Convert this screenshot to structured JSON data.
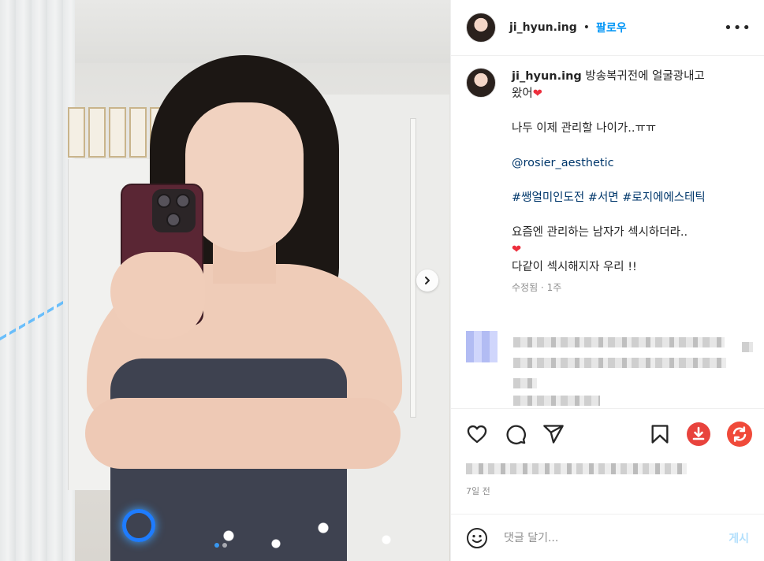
{
  "header": {
    "username": "ji_hyun.ing",
    "separator": "•",
    "follow_label": "팔로우",
    "more_label": "•••"
  },
  "caption": {
    "username": "ji_hyun.ing",
    "line1": "방송복귀전에 얼굴광내고",
    "line2": "왔어",
    "line3": "나두 이제 관리할 나이가..ㅠㅠ",
    "mention": "@rosier_aesthetic",
    "hashtags": "#쌩얼미인도전 #서면 #로지에에스테틱",
    "line5": "요즘엔 관리하는 남자가 섹시하더라..",
    "line6": "다같이 섹시해지자 우리 !!",
    "heart": "❤",
    "meta": "수정됨 · 1주"
  },
  "post_date": "7일 전",
  "comment_box": {
    "placeholder": "댓글 달기...",
    "post_label": "게시"
  },
  "carousel": {
    "slides": 2,
    "active_index": 0
  },
  "icons": {
    "like": "heart-outline-icon",
    "comment": "comment-bubble-icon",
    "share": "paper-plane-icon",
    "save": "bookmark-icon",
    "download": "download-circle-icon",
    "refresh": "refresh-circle-icon",
    "emoji": "smiley-icon",
    "next": "chevron-right-icon"
  },
  "colors": {
    "accent": "#0095f6",
    "mention": "#00376b",
    "heart": "#ed2f3d",
    "download": "#e8433d",
    "refresh": "#f04a3a"
  }
}
